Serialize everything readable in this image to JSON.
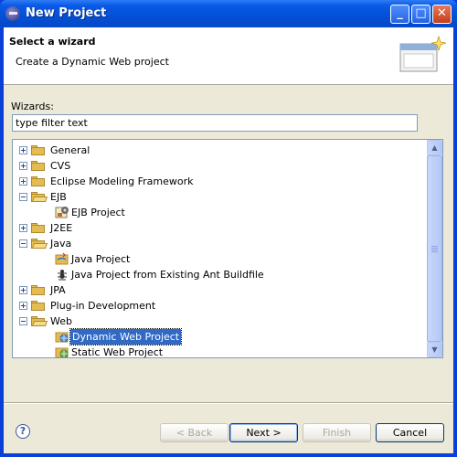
{
  "window": {
    "title": "New Project",
    "controls": {
      "minimize": "_",
      "maximize": "□",
      "close": "✕"
    }
  },
  "header": {
    "title": "Select a wizard",
    "description": "Create a Dynamic Web project"
  },
  "wizards": {
    "label": "Wizards:",
    "filter_value": "type filter text"
  },
  "tree": {
    "items": [
      {
        "label": "General",
        "kind": "folder",
        "expanded": false
      },
      {
        "label": "CVS",
        "kind": "folder",
        "expanded": false
      },
      {
        "label": "Eclipse Modeling Framework",
        "kind": "folder",
        "expanded": false
      },
      {
        "label": "EJB",
        "kind": "folder",
        "expanded": true
      },
      {
        "label": "EJB Project",
        "kind": "item",
        "icon": "ejb-project-icon"
      },
      {
        "label": "J2EE",
        "kind": "folder",
        "expanded": false
      },
      {
        "label": "Java",
        "kind": "folder",
        "expanded": true
      },
      {
        "label": "Java Project",
        "kind": "item",
        "icon": "java-project-icon"
      },
      {
        "label": "Java Project from Existing Ant Buildfile",
        "kind": "item",
        "icon": "ant-icon"
      },
      {
        "label": "JPA",
        "kind": "folder",
        "expanded": false
      },
      {
        "label": "Plug-in Development",
        "kind": "folder",
        "expanded": false
      },
      {
        "label": "Web",
        "kind": "folder",
        "expanded": true
      },
      {
        "label": "Dynamic Web Project",
        "kind": "item",
        "icon": "dynamic-web-project-icon",
        "selected": true
      },
      {
        "label": "Static Web Project",
        "kind": "item",
        "icon": "static-web-project-icon"
      }
    ]
  },
  "buttons": {
    "back": "< Back",
    "next": "Next >",
    "finish": "Finish",
    "cancel": "Cancel",
    "help": "?"
  },
  "colors": {
    "selection": "#316ac5",
    "title_bar": "#0350d6",
    "dialog_bg": "#ece9d8"
  }
}
